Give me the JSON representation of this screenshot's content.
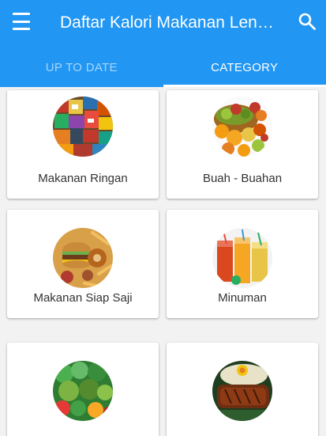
{
  "app_bar": {
    "title": "Daftar Kalori Makanan Lengkap",
    "menu_icon": "menu-icon",
    "search_icon": "search-icon",
    "color": "#2196f3"
  },
  "tabs": [
    {
      "label": "UP TO DATE",
      "active": false
    },
    {
      "label": "CATEGORY",
      "active": true
    }
  ],
  "categories": [
    {
      "label": "Makanan Ringan",
      "image": "snacks-image"
    },
    {
      "label": "Buah - Buahan",
      "image": "fruits-image"
    },
    {
      "label": "Makanan Siap Saji",
      "image": "fast-food-image"
    },
    {
      "label": "Minuman",
      "image": "drinks-image"
    },
    {
      "label": "",
      "image": "vegetables-image"
    },
    {
      "label": "",
      "image": "grilled-meat-image"
    }
  ]
}
